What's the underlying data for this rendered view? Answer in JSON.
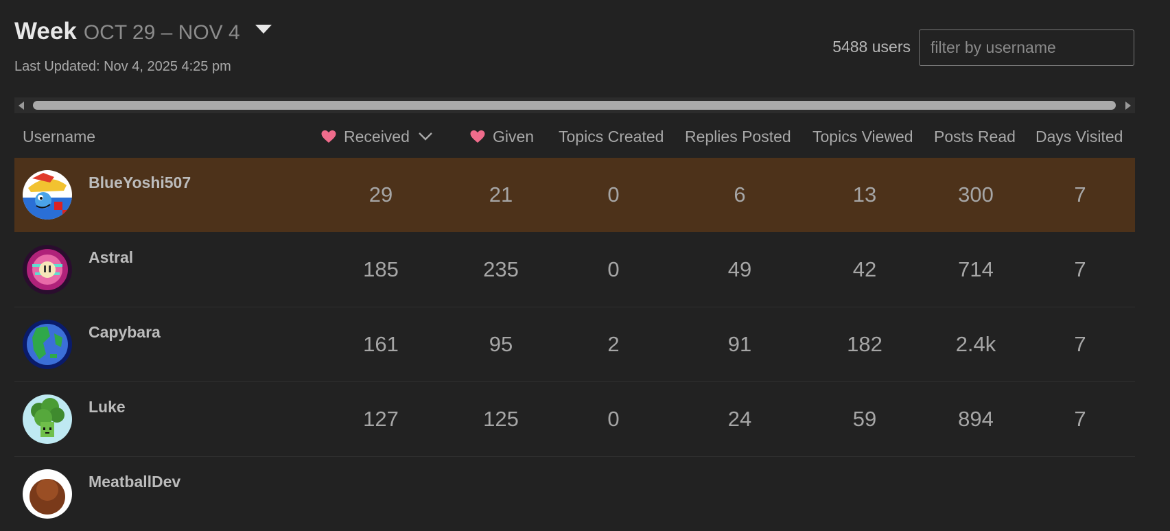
{
  "header": {
    "period": "Week",
    "range": "OCT 29 – NOV 4",
    "last_updated": "Last Updated: Nov 4, 2025 4:25 pm",
    "user_count": "5488 users",
    "filter_placeholder": "filter by username"
  },
  "columns": {
    "username": "Username",
    "received": "Received",
    "given": "Given",
    "topics_created": "Topics Created",
    "replies_posted": "Replies Posted",
    "topics_viewed": "Topics Viewed",
    "posts_read": "Posts Read",
    "days_visited": "Days Visited"
  },
  "rows": [
    {
      "username": "BlueYoshi507",
      "received": "29",
      "given": "21",
      "topics_created": "0",
      "replies_posted": "6",
      "topics_viewed": "13",
      "posts_read": "300",
      "days_visited": "7"
    },
    {
      "username": "Astral",
      "received": "185",
      "given": "235",
      "topics_created": "0",
      "replies_posted": "49",
      "topics_viewed": "42",
      "posts_read": "714",
      "days_visited": "7"
    },
    {
      "username": "Capybara",
      "received": "161",
      "given": "95",
      "topics_created": "2",
      "replies_posted": "91",
      "topics_viewed": "182",
      "posts_read": "2.4k",
      "days_visited": "7"
    },
    {
      "username": "Luke",
      "received": "127",
      "given": "125",
      "topics_created": "0",
      "replies_posted": "24",
      "topics_viewed": "59",
      "posts_read": "894",
      "days_visited": "7"
    },
    {
      "username": "MeatballDev",
      "received": "",
      "given": "",
      "topics_created": "",
      "replies_posted": "",
      "topics_viewed": "",
      "posts_read": "",
      "days_visited": ""
    }
  ],
  "colors": {
    "background": "#222222",
    "highlight_row": "#4d321a",
    "heart": "#f06c8c"
  }
}
